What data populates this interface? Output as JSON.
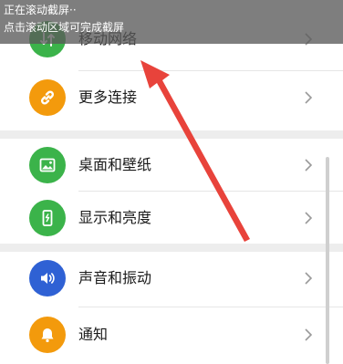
{
  "screenshot_banner": {
    "title": "正在滚动截屏··",
    "hint": "点击滚动区域可完成截屏"
  },
  "settings": {
    "items": [
      {
        "label": "移动网络",
        "icon": "mobile-network-icon",
        "color": "#3bb34a"
      },
      {
        "label": "更多连接",
        "icon": "link-icon",
        "color": "#f39a0c"
      },
      {
        "label": "桌面和壁纸",
        "icon": "wallpaper-icon",
        "color": "#3bb34a"
      },
      {
        "label": "显示和亮度",
        "icon": "display-icon",
        "color": "#3bb34a"
      },
      {
        "label": "声音和振动",
        "icon": "sound-icon",
        "color": "#2f61d4"
      },
      {
        "label": "通知",
        "icon": "bell-icon",
        "color": "#f39a0c"
      }
    ]
  },
  "annotation": {
    "arrow_color": "#e8433b"
  }
}
